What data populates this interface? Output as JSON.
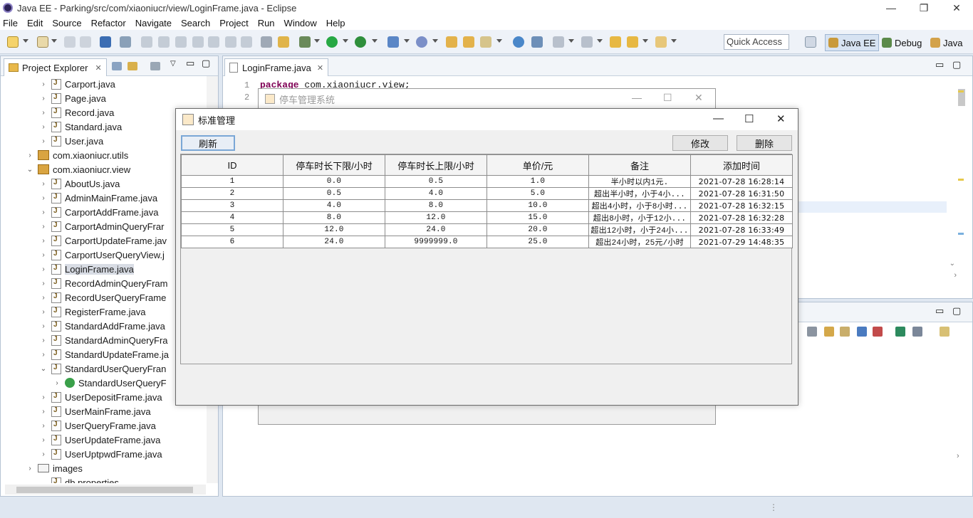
{
  "window": {
    "title": "Java EE - Parking/src/com/xiaoniucr/view/LoginFrame.java - Eclipse",
    "minimize": "—",
    "maximize": "❐",
    "close": "✕"
  },
  "menu": [
    "File",
    "Edit",
    "Source",
    "Refactor",
    "Navigate",
    "Search",
    "Project",
    "Run",
    "Window",
    "Help"
  ],
  "toolbar": {
    "quick_access": "Quick Access",
    "perspectives": [
      "Java EE",
      "Debug",
      "Java"
    ]
  },
  "project_explorer": {
    "tab_label": "Project Explorer",
    "tab_close": "✕",
    "items": [
      {
        "label": "Carport.java",
        "kind": "file",
        "depth": 1,
        "chevron": "›"
      },
      {
        "label": "Page.java",
        "kind": "file",
        "depth": 1,
        "chevron": "›"
      },
      {
        "label": "Record.java",
        "kind": "file",
        "depth": 1,
        "chevron": "›"
      },
      {
        "label": "Standard.java",
        "kind": "file",
        "depth": 1,
        "chevron": "›"
      },
      {
        "label": "User.java",
        "kind": "file",
        "depth": 1,
        "chevron": "›"
      },
      {
        "label": "com.xiaoniucr.utils",
        "kind": "package",
        "depth": 0,
        "chevron": "›"
      },
      {
        "label": "com.xiaoniucr.view",
        "kind": "package",
        "depth": 0,
        "chevron": "⌄"
      },
      {
        "label": "AboutUs.java",
        "kind": "file",
        "depth": 1,
        "chevron": "›"
      },
      {
        "label": "AdminMainFrame.java",
        "kind": "file",
        "depth": 1,
        "chevron": "›"
      },
      {
        "label": "CarportAddFrame.java",
        "kind": "file",
        "depth": 1,
        "chevron": "›"
      },
      {
        "label": "CarportAdminQueryFrar",
        "kind": "file",
        "depth": 1,
        "chevron": "›"
      },
      {
        "label": "CarportUpdateFrame.jav",
        "kind": "file",
        "depth": 1,
        "chevron": "›"
      },
      {
        "label": "CarportUserQueryView.j",
        "kind": "file",
        "depth": 1,
        "chevron": "›"
      },
      {
        "label": "LoginFrame.java",
        "kind": "file",
        "depth": 1,
        "chevron": "›",
        "selected": true
      },
      {
        "label": "RecordAdminQueryFram",
        "kind": "file",
        "depth": 1,
        "chevron": "›"
      },
      {
        "label": "RecordUserQueryFrame",
        "kind": "file",
        "depth": 1,
        "chevron": "›"
      },
      {
        "label": "RegisterFrame.java",
        "kind": "file",
        "depth": 1,
        "chevron": "›"
      },
      {
        "label": "StandardAddFrame.java",
        "kind": "file",
        "depth": 1,
        "chevron": "›"
      },
      {
        "label": "StandardAdminQueryFra",
        "kind": "file",
        "depth": 1,
        "chevron": "›"
      },
      {
        "label": "StandardUpdateFrame.ja",
        "kind": "file",
        "depth": 1,
        "chevron": "›"
      },
      {
        "label": "StandardUserQueryFran",
        "kind": "file",
        "depth": 1,
        "chevron": "⌄"
      },
      {
        "label": "StandardUserQueryF",
        "kind": "class",
        "depth": 2,
        "chevron": "›"
      },
      {
        "label": "UserDepositFrame.java",
        "kind": "file",
        "depth": 1,
        "chevron": "›"
      },
      {
        "label": "UserMainFrame.java",
        "kind": "file",
        "depth": 1,
        "chevron": "›"
      },
      {
        "label": "UserQueryFrame.java",
        "kind": "file",
        "depth": 1,
        "chevron": "›"
      },
      {
        "label": "UserUpdateFrame.java",
        "kind": "file",
        "depth": 1,
        "chevron": "›"
      },
      {
        "label": "UserUptpwdFrame.java",
        "kind": "file",
        "depth": 1,
        "chevron": "›"
      },
      {
        "label": "images",
        "kind": "folder",
        "depth": 0,
        "chevron": "›"
      },
      {
        "label": "db.properties",
        "kind": "file",
        "depth": 1,
        "chevron": ""
      }
    ]
  },
  "editor": {
    "tab_label": "LoginFrame.java",
    "tab_close": "✕",
    "lines": [
      {
        "num": "1",
        "keyword": "package",
        "rest": " com.xiaoniucr.view;"
      },
      {
        "num": "2",
        "keyword": "",
        "rest": ""
      }
    ]
  },
  "bg_window": {
    "title": "停车管理系统"
  },
  "standard_window": {
    "title": "标准管理",
    "minimize": "—",
    "maximize": "☐",
    "close": "✕",
    "refresh_label": "刷新",
    "edit_label": "修改",
    "delete_label": "删除",
    "columns": [
      "ID",
      "停车时长下限/小时",
      "停车时长上限/小时",
      "单价/元",
      "备注",
      "添加时间"
    ],
    "rows": [
      [
        "1",
        "0.0",
        "0.5",
        "1.0",
        "半小时以内1元.",
        "2021-07-28 16:28:14"
      ],
      [
        "2",
        "0.5",
        "4.0",
        "5.0",
        "超出半小时，小于4小...",
        "2021-07-28 16:31:50"
      ],
      [
        "3",
        "4.0",
        "8.0",
        "10.0",
        "超出4小时，小于8小时...",
        "2021-07-28 16:32:15"
      ],
      [
        "4",
        "8.0",
        "12.0",
        "15.0",
        "超出8小时，小于12小...",
        "2021-07-28 16:32:28"
      ],
      [
        "5",
        "12.0",
        "24.0",
        "20.0",
        "超出12小时，小于24小...",
        "2021-07-28 16:33:49"
      ],
      [
        "6",
        "24.0",
        "9999999.0",
        "25.0",
        "超出24小时，25元/小时",
        "2021-07-29 14:48:35"
      ]
    ]
  }
}
